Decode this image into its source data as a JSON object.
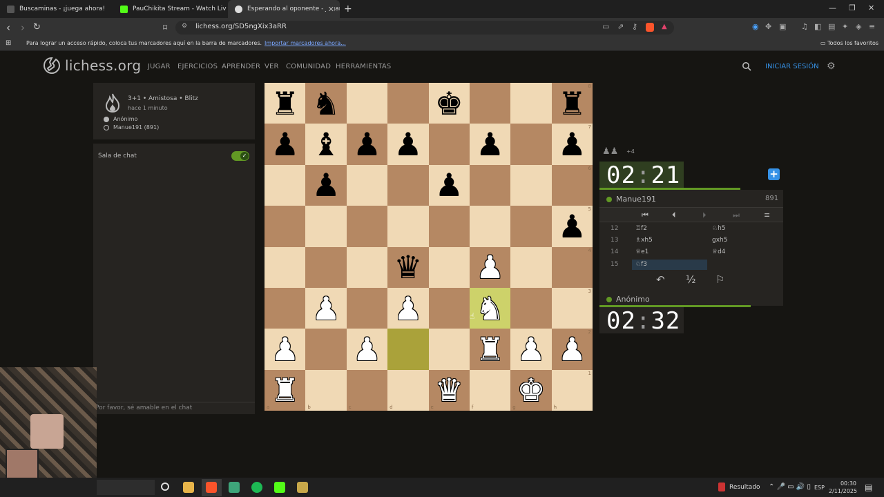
{
  "browser": {
    "tabs": [
      {
        "title": "Buscaminas - ¡juega ahora!",
        "color": "#555555"
      },
      {
        "title": "PauChikita Stream - Watch Live o",
        "color": "#53fc18"
      },
      {
        "title": "Esperando al oponente - Jugar M",
        "color": "#dddddd"
      }
    ],
    "url": "lichess.org/SD5ngXix3aRR",
    "bookmark_bar_text": "Para lograr un acceso rápido, coloca tus marcadores aquí en la barra de marcadores.",
    "bookmark_import_link": "Importar marcadores ahora...",
    "all_favorites": "Todos los favoritos"
  },
  "site": {
    "logo": "lichess.org",
    "menu": [
      "JUGAR",
      "EJERCICIOS",
      "APRENDER",
      "VER",
      "COMUNIDAD",
      "HERRAMIENTAS"
    ],
    "login": "INICIAR SESIÓN"
  },
  "game": {
    "title": "3+1 • Amistosa • Blitz",
    "time_ago": "hace 1 minuto",
    "player_white": "Anónimo",
    "player_black": "Manue191 (891)"
  },
  "chat": {
    "label": "Sala de chat",
    "placeholder": "Por favor, sé amable en el chat"
  },
  "board": {
    "ranks": [
      [
        "br",
        "bn",
        "",
        "",
        "bk",
        "",
        "",
        "br"
      ],
      [
        "bp",
        "bb",
        "bp",
        "bp",
        "",
        "bp",
        "",
        "bp"
      ],
      [
        "",
        "bp",
        "",
        "",
        "bp",
        "",
        "",
        ""
      ],
      [
        "",
        "",
        "",
        "",
        "",
        "",
        "",
        "bp"
      ],
      [
        "",
        "",
        "",
        "bq",
        "",
        "wp",
        "",
        ""
      ],
      [
        "",
        "wp",
        "",
        "wp",
        "",
        "wn",
        "",
        ""
      ],
      [
        "wp",
        "",
        "wp",
        "",
        "",
        "wr",
        "wp",
        "wp"
      ],
      [
        "wr",
        "",
        "",
        "",
        "wq",
        "",
        "wk",
        ""
      ]
    ],
    "highlight": [
      "d2",
      "f3"
    ],
    "rank_labels": [
      "8",
      "7",
      "6",
      "5",
      "4",
      "3",
      "2",
      "1"
    ],
    "file_labels": [
      "a",
      "b",
      "c",
      "d",
      "e",
      "f",
      "g",
      "h"
    ]
  },
  "opponent": {
    "name": "Manue191",
    "rating": "891",
    "clock_min": "02",
    "clock_sec": "21",
    "material_plus": "+4"
  },
  "me": {
    "name": "Anónimo",
    "clock_min": "02",
    "clock_sec": "32"
  },
  "moves": [
    {
      "n": "12",
      "w": "♖f2",
      "b": "♘h5"
    },
    {
      "n": "13",
      "w": "♗xh5",
      "b": "gxh5"
    },
    {
      "n": "14",
      "w": "♕e1",
      "b": "♕d4"
    },
    {
      "n": "15",
      "w": "♘f3",
      "b": ""
    }
  ],
  "draw_label": "½",
  "taskbar": {
    "resultado": "Resultado",
    "lang": "ESP",
    "time": "00:30",
    "date": "2/11/2025"
  }
}
